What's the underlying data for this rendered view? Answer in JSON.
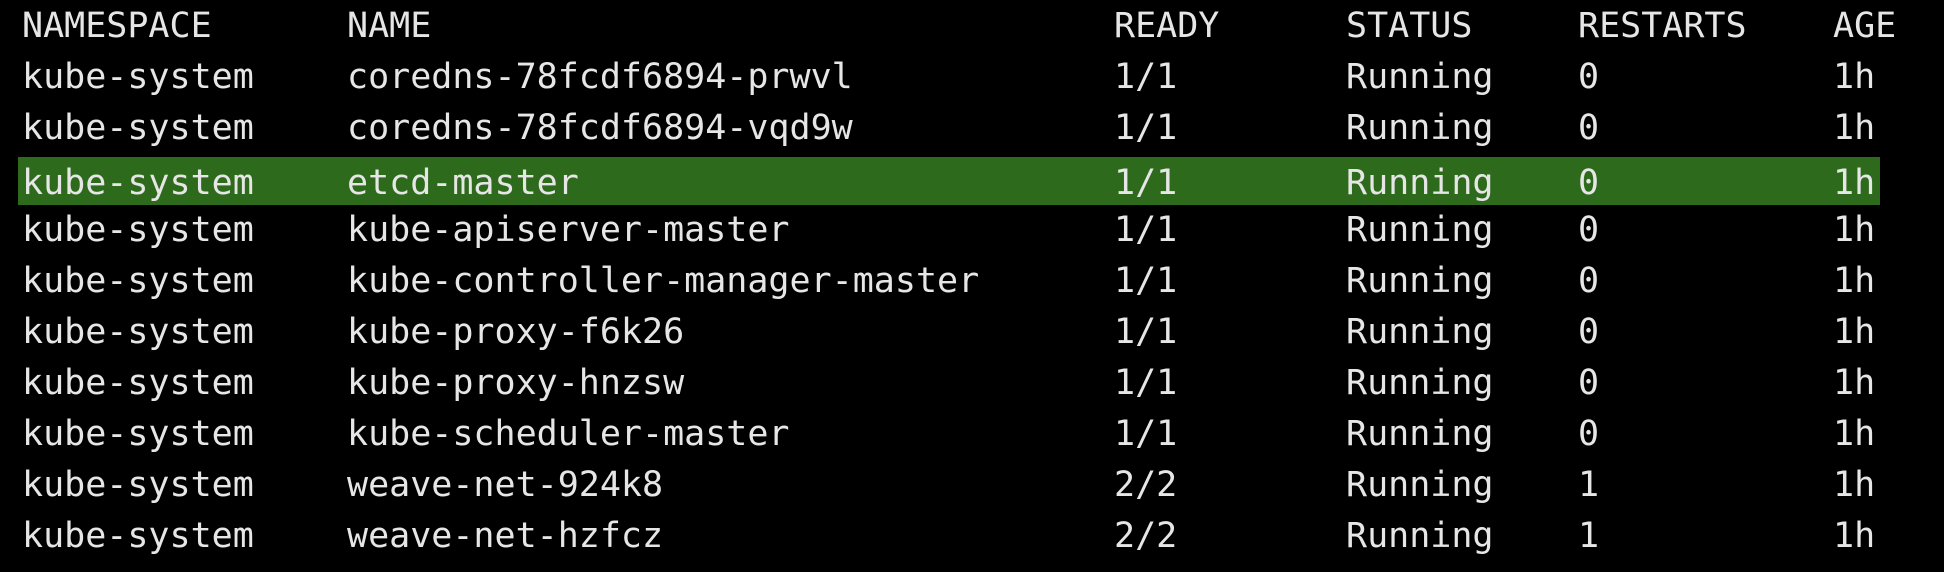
{
  "columns": {
    "namespace": "NAMESPACE",
    "name": "NAME",
    "ready": "READY",
    "status": "STATUS",
    "restarts": "RESTARTS",
    "age": "AGE"
  },
  "pods": [
    {
      "namespace": "kube-system",
      "name": "coredns-78fcdf6894-prwvl",
      "ready": "1/1",
      "status": "Running",
      "restarts": "0",
      "age": "1h"
    },
    {
      "namespace": "kube-system",
      "name": "coredns-78fcdf6894-vqd9w",
      "ready": "1/1",
      "status": "Running",
      "restarts": "0",
      "age": "1h"
    },
    {
      "namespace": "kube-system",
      "name": "etcd-master",
      "ready": "1/1",
      "status": "Running",
      "restarts": "0",
      "age": "1h"
    },
    {
      "namespace": "kube-system",
      "name": "kube-apiserver-master",
      "ready": "1/1",
      "status": "Running",
      "restarts": "0",
      "age": "1h"
    },
    {
      "namespace": "kube-system",
      "name": "kube-controller-manager-master",
      "ready": "1/1",
      "status": "Running",
      "restarts": "0",
      "age": "1h"
    },
    {
      "namespace": "kube-system",
      "name": "kube-proxy-f6k26",
      "ready": "1/1",
      "status": "Running",
      "restarts": "0",
      "age": "1h"
    },
    {
      "namespace": "kube-system",
      "name": "kube-proxy-hnzsw",
      "ready": "1/1",
      "status": "Running",
      "restarts": "0",
      "age": "1h"
    },
    {
      "namespace": "kube-system",
      "name": "kube-scheduler-master",
      "ready": "1/1",
      "status": "Running",
      "restarts": "0",
      "age": "1h"
    },
    {
      "namespace": "kube-system",
      "name": "weave-net-924k8",
      "ready": "2/2",
      "status": "Running",
      "restarts": "1",
      "age": "1h"
    },
    {
      "namespace": "kube-system",
      "name": "weave-net-hzfcz",
      "ready": "2/2",
      "status": "Running",
      "restarts": "1",
      "age": "1h"
    }
  ],
  "highlight_color": "#2e6a1c",
  "background_color": "#000000",
  "text_color": "#e6e6e6"
}
